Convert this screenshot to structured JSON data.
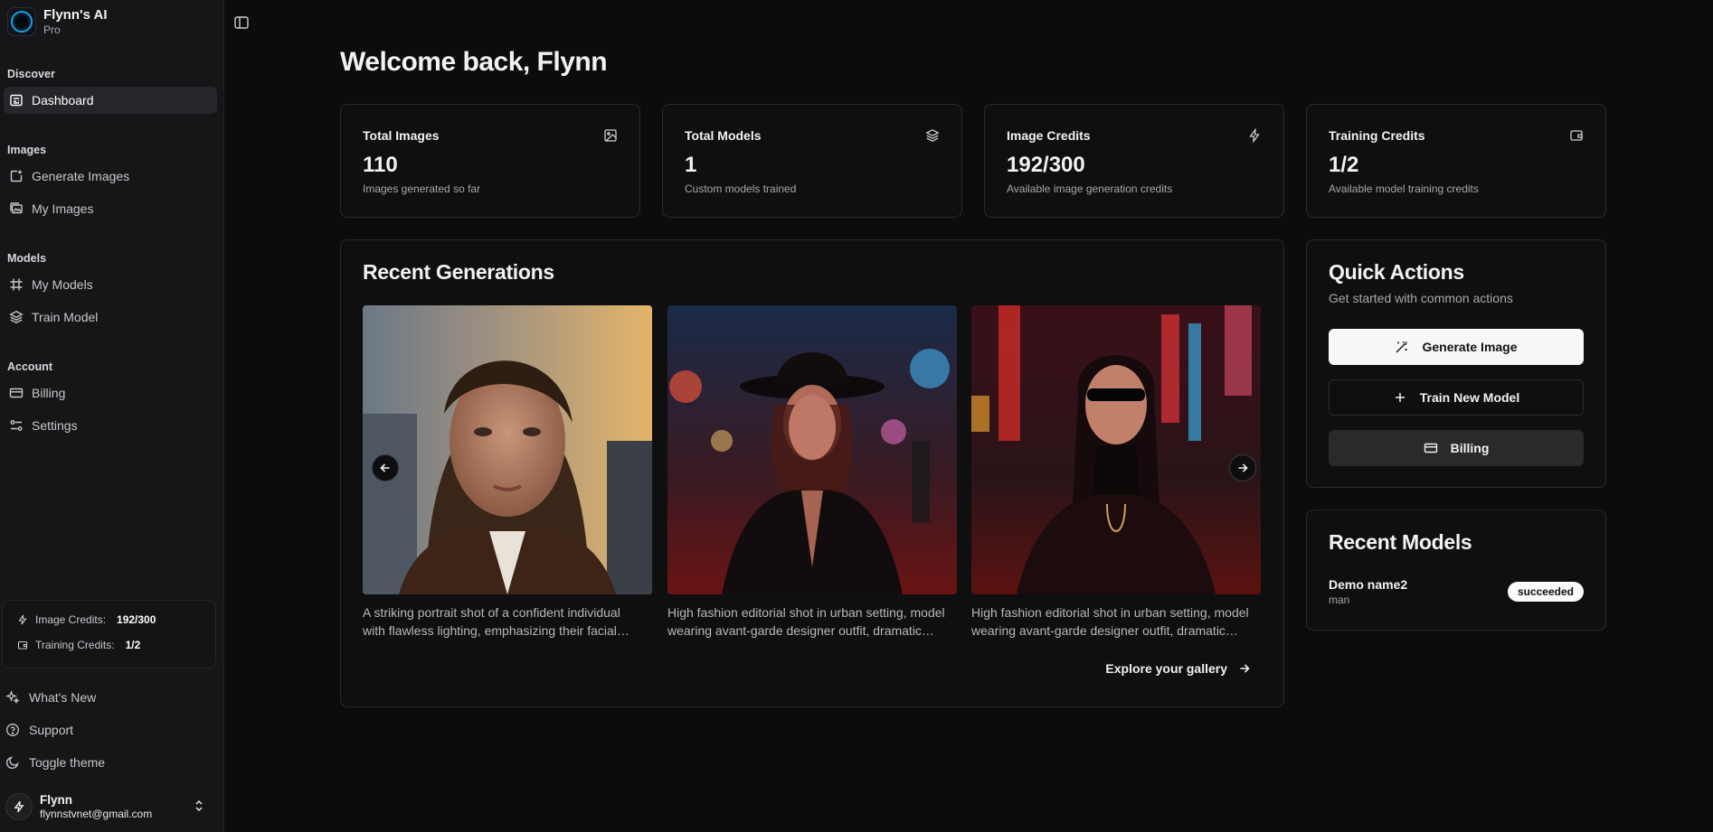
{
  "app": {
    "name": "Flynn's AI",
    "plan": "Pro"
  },
  "sidebar": {
    "sections": [
      {
        "label": "Discover",
        "items": [
          {
            "label": "Dashboard",
            "icon": "dashboard-icon",
            "active": true
          }
        ]
      },
      {
        "label": "Images",
        "items": [
          {
            "label": "Generate Images",
            "icon": "image-plus-icon"
          },
          {
            "label": "My Images",
            "icon": "images-icon"
          }
        ]
      },
      {
        "label": "Models",
        "items": [
          {
            "label": "My Models",
            "icon": "frame-icon"
          },
          {
            "label": "Train Model",
            "icon": "layers-icon"
          }
        ]
      },
      {
        "label": "Account",
        "items": [
          {
            "label": "Billing",
            "icon": "credit-card-icon"
          },
          {
            "label": "Settings",
            "icon": "sliders-icon"
          }
        ]
      }
    ],
    "credits": {
      "image_label": "Image Credits:",
      "image_value": "192/300",
      "training_label": "Training Credits:",
      "training_value": "1/2"
    },
    "footer": [
      {
        "label": "What's New",
        "icon": "sparkles-icon"
      },
      {
        "label": "Support",
        "icon": "help-circle-icon"
      },
      {
        "label": "Toggle theme",
        "icon": "moon-icon"
      }
    ],
    "user": {
      "name": "Flynn",
      "email": "flynnstvnet@gmail.com"
    }
  },
  "main": {
    "title": "Welcome back, Flynn",
    "stats": [
      {
        "label": "Total Images",
        "value": "110",
        "desc": "Images generated so far",
        "icon": "image-icon"
      },
      {
        "label": "Total Models",
        "value": "1",
        "desc": "Custom models trained",
        "icon": "layers-icon"
      },
      {
        "label": "Image Credits",
        "value": "192/300",
        "desc": "Available image generation credits",
        "icon": "zap-icon"
      },
      {
        "label": "Training Credits",
        "value": "1/2",
        "desc": "Available model training credits",
        "icon": "wallet-icon"
      }
    ],
    "recent_generations": {
      "title": "Recent Generations",
      "items": [
        {
          "caption_1": "A striking portrait shot of a confident individual",
          "caption_2": "with flawless lighting, emphasizing their facial…"
        },
        {
          "caption_1": "High fashion editorial shot in urban setting, model",
          "caption_2": "wearing avant-garde designer outfit, dramatic…"
        },
        {
          "caption_1": "High fashion editorial shot in urban setting, model",
          "caption_2": "wearing avant-garde designer outfit, dramatic…"
        }
      ],
      "explore_label": "Explore your gallery"
    },
    "quick_actions": {
      "title": "Quick Actions",
      "subtitle": "Get started with common actions",
      "buttons": [
        {
          "label": "Generate Image"
        },
        {
          "label": "Train New Model"
        },
        {
          "label": "Billing"
        }
      ]
    },
    "recent_models": {
      "title": "Recent Models",
      "items": [
        {
          "name": "Demo name2",
          "type": "man",
          "status": "succeeded"
        }
      ]
    }
  }
}
